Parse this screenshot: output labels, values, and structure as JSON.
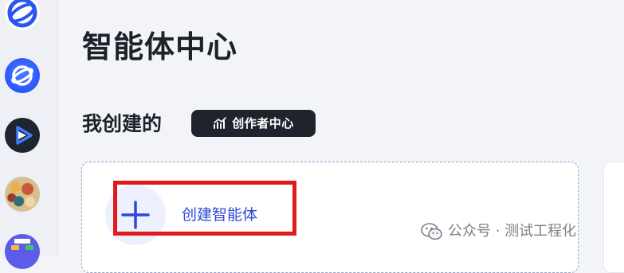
{
  "sidebar": {
    "items": [
      {
        "name": "app-avatar-1",
        "icon": "ring-logo-icon"
      },
      {
        "name": "app-avatar-2",
        "icon": "ring-logo-icon"
      },
      {
        "name": "app-avatar-3",
        "icon": "play-logo-icon"
      },
      {
        "name": "app-avatar-4",
        "icon": "pattern-avatar"
      },
      {
        "name": "app-avatar-5",
        "icon": "flow-logo-icon"
      }
    ]
  },
  "main": {
    "title": "智能体中心",
    "section_title": "我创建的",
    "creator_badge": {
      "label": "创作者中心",
      "icon": "chart-trend-icon"
    },
    "create_card": {
      "label": "创建智能体",
      "icon": "plus-icon"
    }
  },
  "watermark": {
    "text": "公众号 · 测试工程化",
    "icon": "wechat-icon"
  },
  "colors": {
    "background": "#f3f4f8",
    "accent": "#2e49d6",
    "highlight": "#e01b1b",
    "badge_bg": "#1f232b",
    "title": "#1d2129"
  }
}
